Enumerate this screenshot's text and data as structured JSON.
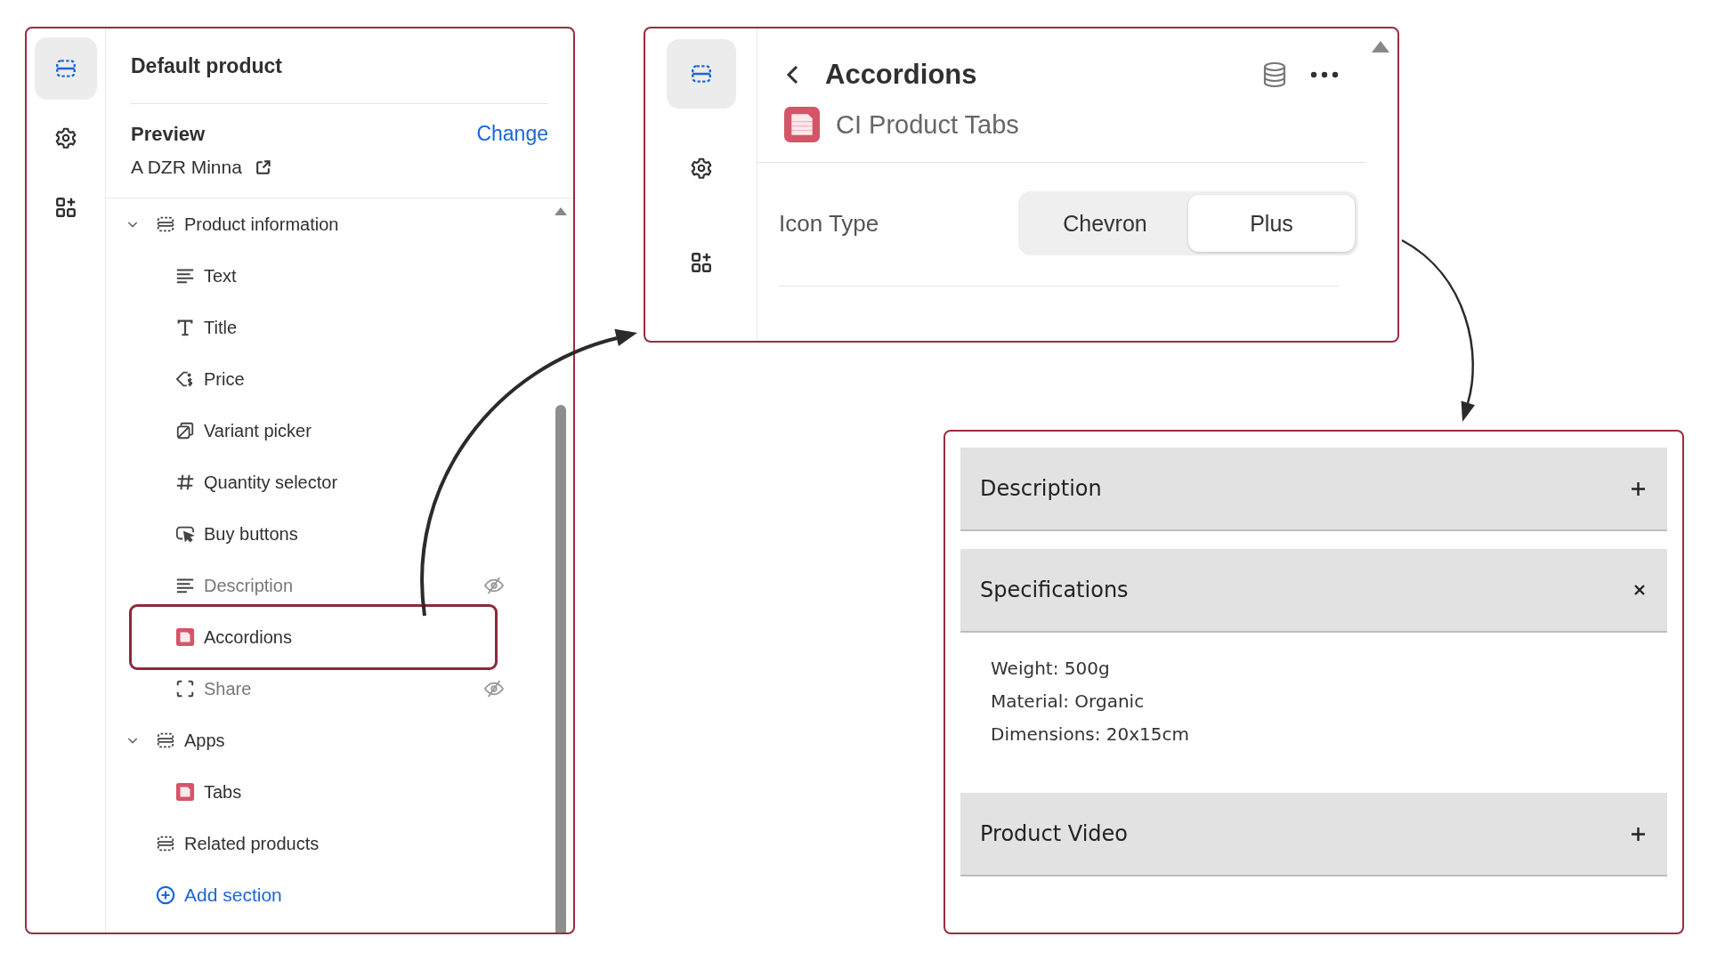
{
  "editor_panel": {
    "rail": [
      {
        "kind": "sections",
        "selected": true
      },
      {
        "kind": "settings",
        "selected": false
      },
      {
        "kind": "apps",
        "selected": false
      }
    ],
    "title": "Default product",
    "preview": {
      "label": "Preview",
      "action": "Change",
      "value": "A DZR Minna"
    },
    "tree": [
      {
        "label": "Product information",
        "kind": "section",
        "expanded": true,
        "children": [
          {
            "label": "Text",
            "kind": "text",
            "hidden": false,
            "selected": false
          },
          {
            "label": "Title",
            "kind": "title",
            "hidden": false,
            "selected": false
          },
          {
            "label": "Price",
            "kind": "price",
            "hidden": false,
            "selected": false
          },
          {
            "label": "Variant picker",
            "kind": "variant",
            "hidden": false,
            "selected": false
          },
          {
            "label": "Quantity selector",
            "kind": "quantity",
            "hidden": false,
            "selected": false
          },
          {
            "label": "Buy buttons",
            "kind": "buy",
            "hidden": false,
            "selected": false
          },
          {
            "label": "Description",
            "kind": "text",
            "hidden": true,
            "selected": false
          },
          {
            "label": "Accordions",
            "kind": "app",
            "hidden": false,
            "selected": true
          },
          {
            "label": "Share",
            "kind": "share",
            "hidden": true,
            "selected": false
          }
        ]
      },
      {
        "label": "Apps",
        "kind": "section",
        "expanded": true,
        "children": [
          {
            "label": "Tabs",
            "kind": "app",
            "hidden": false,
            "selected": false
          }
        ]
      },
      {
        "label": "Related products",
        "kind": "section"
      }
    ],
    "add_section": "Add section"
  },
  "block_panel": {
    "rail": [
      {
        "kind": "sections",
        "selected": true
      },
      {
        "kind": "settings",
        "selected": false
      },
      {
        "kind": "apps",
        "selected": false
      }
    ],
    "title": "Accordions",
    "app_name": "CI Product Tabs",
    "setting": {
      "label": "Icon Type",
      "options": [
        {
          "label": "Chevron",
          "selected": false
        },
        {
          "label": "Plus",
          "selected": true
        }
      ]
    }
  },
  "accordion_preview": {
    "items": [
      {
        "title": "Description",
        "expanded": false
      },
      {
        "title": "Specifications",
        "expanded": true,
        "content": [
          "Weight: 500g",
          "Material: Organic",
          "Dimensions: 20x15cm"
        ]
      },
      {
        "title": "Product Video",
        "expanded": false
      }
    ]
  }
}
